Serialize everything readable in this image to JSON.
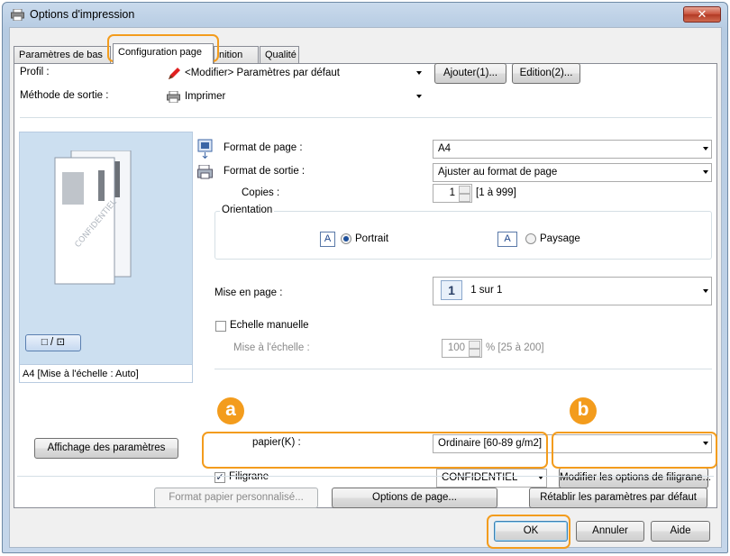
{
  "window": {
    "title": "Options d'impression",
    "close_glyph": "✕"
  },
  "tabs": [
    {
      "label": "Paramètres de bas",
      "active": false
    },
    {
      "label": "Configuration page",
      "active": true
    },
    {
      "label": "nition",
      "active": false
    },
    {
      "label": "Qualité",
      "active": false
    }
  ],
  "profile": {
    "label": "Profil :",
    "value": "<Modifier> Paramètres par défaut",
    "add_button": "Ajouter(1)...",
    "edit_button": "Edition(2)..."
  },
  "output": {
    "label": "Méthode de sortie :",
    "value": "Imprimer"
  },
  "preview": {
    "caption": "A4 [Mise à l'échelle : Auto]",
    "view_toggle": "□ / ⊡"
  },
  "show_settings_button": "Affichage des paramètres",
  "page_size": {
    "label": "Format de page :",
    "value": "A4"
  },
  "output_size": {
    "label": "Format de sortie :",
    "value": "Ajuster au format de page"
  },
  "copies": {
    "label": "Copies :",
    "value": "1",
    "range": "[1 à 999]"
  },
  "orientation": {
    "label": "Orientation",
    "portrait": "Portrait",
    "landscape": "Paysage",
    "icon_letter": "A",
    "selected": "portrait"
  },
  "layout": {
    "label": "Mise en page :",
    "value": "1 sur 1",
    "icon_number": "1"
  },
  "manual_scaling": {
    "label": "Echelle manuelle",
    "checked": false
  },
  "scaling": {
    "label": "Mise à l'échelle :",
    "value": "100",
    "range": "% [25 à 200]"
  },
  "paper_type": {
    "label": "papier(K) :",
    "value": "Ordinaire [60-89 g/m2]"
  },
  "watermark": {
    "label": "Filigrane",
    "checked": true,
    "check_glyph": "✓",
    "value": "CONFIDENTIEL",
    "edit_button": "Modifier les options de filigrane..."
  },
  "bottom_buttons": {
    "custom_paper": "Format papier personnalisé...",
    "page_options": "Options de page...",
    "restore": "Rétablir les paramètres par défaut"
  },
  "dialog_buttons": {
    "ok": "OK",
    "cancel": "Annuler",
    "help": "Aide"
  },
  "callouts": {
    "a": "a",
    "b": "b"
  },
  "colors": {
    "highlight": "#f39c1d",
    "preview_bg": "#ccdff0",
    "title_bg": "#b6cbe2"
  }
}
